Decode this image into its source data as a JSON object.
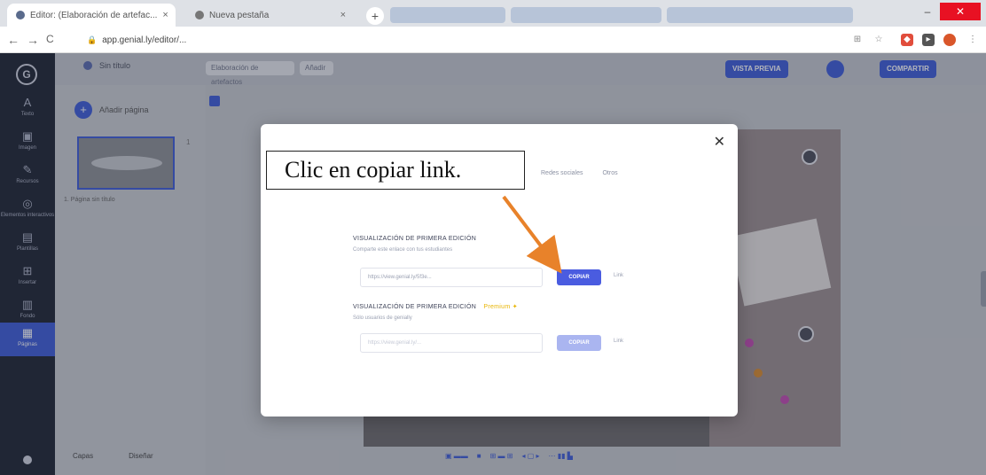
{
  "browser": {
    "tabs": [
      {
        "title": "Editor: (Elaboración de artefac...",
        "active": true
      },
      {
        "title": "Nueva pestaña",
        "active": false
      }
    ],
    "new_tab": "+",
    "url": "app.genial.ly/editor/...",
    "nav": {
      "back": "←",
      "forward": "→",
      "reload": "C"
    }
  },
  "sidebar": {
    "logo": "G",
    "items": [
      {
        "icon": "A",
        "label": "Texto"
      },
      {
        "icon": "▣",
        "label": "Imagen"
      },
      {
        "icon": "✎",
        "label": "Recursos"
      },
      {
        "icon": "◎",
        "label": "Elementos interactivos"
      },
      {
        "icon": "▤",
        "label": "Plantillas"
      },
      {
        "icon": "⊞",
        "label": "Insertar"
      },
      {
        "icon": "▥",
        "label": "Fondo"
      },
      {
        "icon": "▦",
        "label": "Páginas"
      }
    ]
  },
  "topbar": {
    "title": "Sin título",
    "pill_1": "Elaboración de artefactos",
    "pill_2": "Añadir",
    "primary_button": "VISTA PREVIA",
    "publish_button": "COMPARTIR"
  },
  "slide_panel": {
    "add_label": "Añadir página",
    "page_number": "1",
    "thumb_caption": "1. Página sin título",
    "footer": [
      "Capas",
      "Diseñar"
    ]
  },
  "modal": {
    "callout_text": "Clic en copiar link.",
    "share_tabs": [
      "Redes sociales",
      "Otros"
    ],
    "section1": {
      "title": "VISUALIZACIÓN DE PRIMERA EDICIÓN",
      "subtitle": "Comparte este enlace con tus estudiantes",
      "link_value": "https://view.genial.ly/5f3e...",
      "copy_label": "COPIAR",
      "extra_link": "Link"
    },
    "section2": {
      "title": "VISUALIZACIÓN DE PRIMERA EDICIÓN",
      "premium": "Premium ✦",
      "subtitle": "Sólo usuarios de genially",
      "link_value": "https://view.genial.ly/...",
      "copy_label": "COPIAR",
      "extra_link": "Link"
    }
  },
  "colors": {
    "accent": "#3d5bd9",
    "arrow": "#e8822a",
    "sidebar": "#1d2232"
  }
}
